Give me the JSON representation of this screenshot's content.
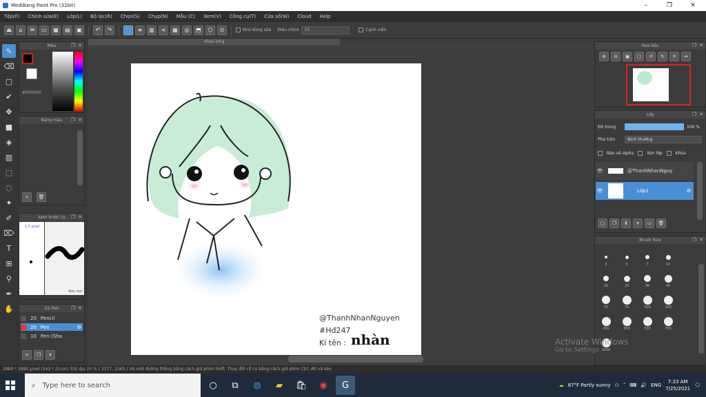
{
  "window": {
    "title": "MediBang Paint Pro (32bit)"
  },
  "menu": [
    "Tệp(F)",
    "Chỉnh sửa(E)",
    "Lớp(L)",
    "Bộ lọc(R)",
    "Chọn(S)",
    "Chụp(N)",
    "Mẫu (C)",
    "Xem(V)",
    "Công cụ(T)",
    "Cửa sổ(W)",
    "Cloud",
    "Help"
  ],
  "toolbar": {
    "stabilizer_label": "Khử dùng sửa",
    "adjust_label": "Điều chỉnh",
    "adjust_value": "15",
    "snap_label": "Cạnh viền"
  },
  "tab": {
    "label": "chưa lưng"
  },
  "color_panel": {
    "title": "Màu",
    "hex": "#000000"
  },
  "brush_panel": {
    "title": "Bảng màu"
  },
  "brush_preview_panel": {
    "title": "Xem trước cọ",
    "left_label": "1.0 pixel",
    "right_label": "Bảo mịn"
  },
  "brush_list": {
    "title": "Cọ Pen",
    "items": [
      {
        "size": "20",
        "name": "Pencil"
      },
      {
        "size": "20",
        "name": "Pen"
      },
      {
        "size": "10",
        "name": "Pen (Sha"
      }
    ]
  },
  "navigator": {
    "title": "Hoa tiêu"
  },
  "layer_panel": {
    "title": "Lớp",
    "opacity_label": "Độ trong",
    "opacity_value": "100 %",
    "opacity_fraction": 1.0,
    "blend_label": "Pha trộn",
    "blend_value": "Bình thường",
    "protect_label": "Bảo vệ alpha",
    "clip_label": "Xén lớp",
    "lock_label": "Khóa",
    "layers": [
      {
        "name": "@ThanhNhanNguy",
        "selected": false
      },
      {
        "name": "Lớp1",
        "selected": true
      }
    ]
  },
  "brush_size_panel": {
    "title": "Brush Size",
    "labels": [
      "3",
      "5",
      "7",
      "10",
      "15",
      "20",
      "30",
      "40",
      "50",
      "70",
      "100",
      "150",
      "200",
      "300",
      "500",
      "700",
      "1000"
    ]
  },
  "signature": {
    "line1": "@ThanhNhanNguyen",
    "line2": "#Hđ247",
    "line3": "Kí tên :",
    "handwritten": "nhàn"
  },
  "status": {
    "text": "2880 * 2880 pixel  (243 * 21cm)  350 dpi  20 %  ( 3377, 1565 )  Vẽ một đường thẳng bằng cách giữ phím Shift. Thay đổi cỡ cọ bằng cách giữ phím Ctrl, Alt và kéo"
  },
  "watermark": {
    "line1": "Activate Windows",
    "line2": "Go to Settings"
  },
  "taskbar": {
    "search_placeholder": "Type here to search",
    "weather": "87°F Partly sunny",
    "lang": "ENG",
    "time": "7:23 AM",
    "date": "7/25/2021"
  }
}
